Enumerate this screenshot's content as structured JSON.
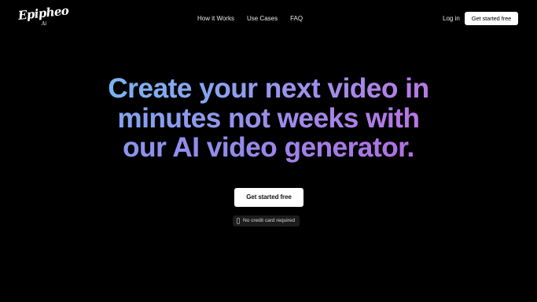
{
  "header": {
    "logo": {
      "wordmark": "Epipheo",
      "sub": "Ai"
    },
    "nav": [
      {
        "label": "How it Works"
      },
      {
        "label": "Use Cases"
      },
      {
        "label": "FAQ"
      }
    ],
    "login_label": "Log in",
    "cta_label": "Get started free"
  },
  "hero": {
    "title_lines": [
      "Create your next video in",
      "minutes not weeks with",
      "our AI video generator."
    ],
    "cta_label": "Get started free",
    "badge": {
      "icon": "credit-card-icon",
      "text": "No credit card required"
    }
  },
  "colors": {
    "background": "#000000",
    "gradient_start": "#6ac4f2",
    "gradient_end": "#c466de",
    "button_bg": "#ffffff",
    "badge_bg": "#1c1c1c"
  }
}
